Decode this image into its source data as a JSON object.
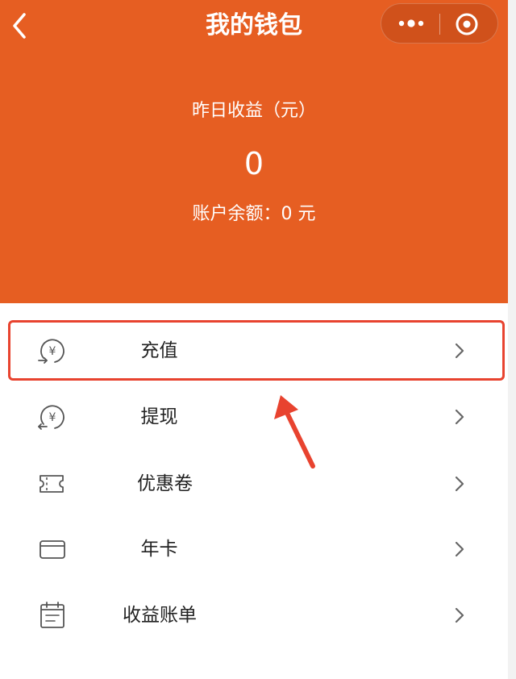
{
  "nav": {
    "title": "我的钱包"
  },
  "summary": {
    "earnings_label": "昨日收益（元）",
    "earnings_value": "0",
    "balance_line": "账户余额：0 元"
  },
  "menu": {
    "items": [
      {
        "label": "充值",
        "icon": "yuan-recharge-icon"
      },
      {
        "label": "提现",
        "icon": "yuan-withdraw-icon"
      },
      {
        "label": "优惠卷",
        "icon": "ticket-icon"
      },
      {
        "label": "年卡",
        "icon": "card-icon"
      },
      {
        "label": "收益账单",
        "icon": "calendar-bill-icon"
      }
    ]
  },
  "colors": {
    "brand": "#e65e22",
    "highlight": "#e8432f"
  }
}
